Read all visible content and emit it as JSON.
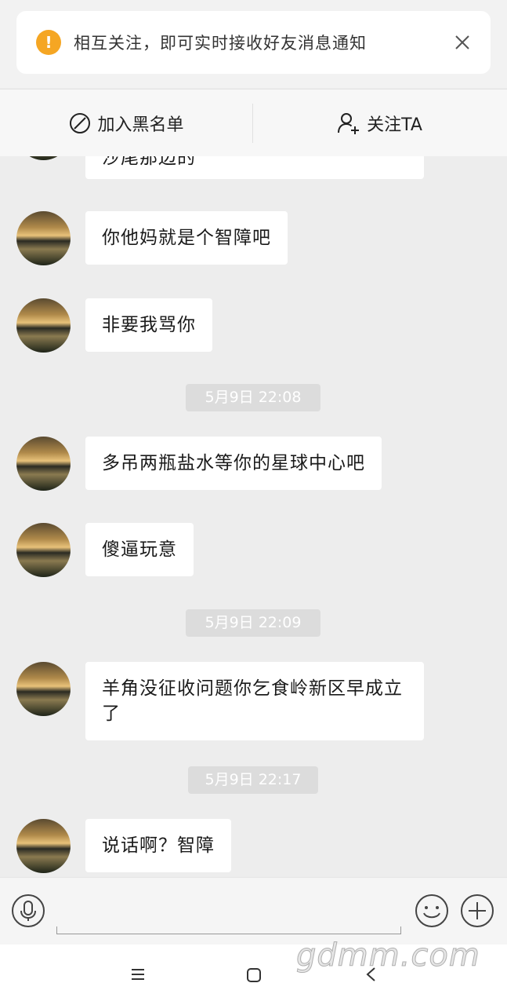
{
  "notice": {
    "text": "相互关注，即可实时接收好友消息通知",
    "warn_symbol": "!"
  },
  "actions": {
    "blacklist_label": "加入黑名单",
    "follow_label": "关注TA"
  },
  "chat": {
    "messages": [
      {
        "text": "沙尾那边的"
      },
      {
        "text": "你他妈就是个智障吧"
      },
      {
        "text": "非要我骂你"
      },
      {
        "text": "多吊两瓶盐水等你的星球中心吧"
      },
      {
        "text": "傻逼玩意"
      },
      {
        "text": "羊角没征收问题你乞食岭新区早成立了"
      },
      {
        "text": "说话啊？智障"
      }
    ],
    "timestamps": [
      "5月9日 22:08",
      "5月9日 22:09",
      "5月9日 22:17"
    ]
  },
  "watermark": "gdmm.com",
  "colors": {
    "background": "#ededed",
    "bubble": "#ffffff",
    "warning": "#f5a623",
    "timestamp_bg": "#dcdcdc"
  }
}
